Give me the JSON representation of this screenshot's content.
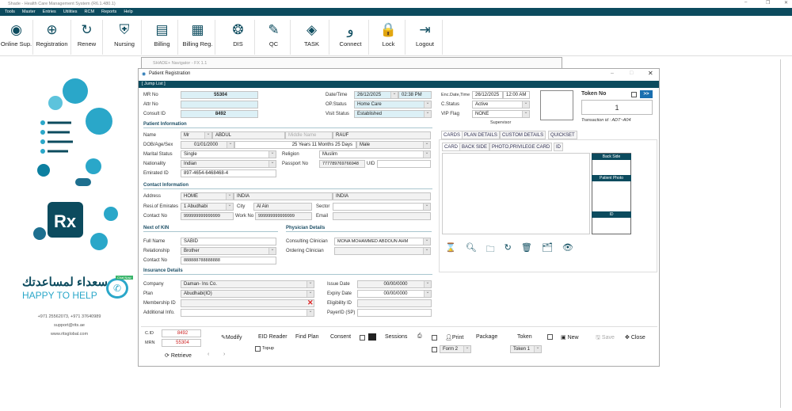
{
  "app": {
    "title": "Shade - Health Care Management System (R6.1.480.1)"
  },
  "menu": [
    "Tools",
    "Master",
    "Entries",
    "Utilities",
    "RCM",
    "Reports",
    "Help"
  ],
  "toolbar": [
    {
      "label": "Online Sup.",
      "icon": "online-support-icon",
      "glyph": "◉"
    },
    {
      "label": "Registration",
      "icon": "registration-icon",
      "glyph": "⊕"
    },
    {
      "label": "Renew",
      "icon": "renew-icon",
      "glyph": "↻"
    },
    {
      "label": "Nursing",
      "icon": "nursing-icon",
      "glyph": "⛨"
    },
    {
      "label": "Billing",
      "icon": "billing-icon",
      "glyph": "▤"
    },
    {
      "label": "Billing Reg.",
      "icon": "billing-register-icon",
      "glyph": "▦"
    },
    {
      "label": "DIS",
      "icon": "dis-icon",
      "glyph": "❂"
    },
    {
      "label": "QC",
      "icon": "qc-icon",
      "glyph": "✎"
    },
    {
      "label": "TASK",
      "icon": "task-icon",
      "glyph": "◈"
    },
    {
      "label": "Connect",
      "icon": "connect-icon",
      "glyph": "ﻭ"
    },
    {
      "label": "Lock",
      "icon": "lock-icon",
      "glyph": "🔒"
    },
    {
      "label": "Logout",
      "icon": "logout-icon",
      "glyph": "⇥"
    }
  ],
  "sidebar": {
    "arabic": "سعداء لمساعدتك",
    "slogan": "HAPPY TO HELP",
    "badge": "Chat Now",
    "phone": "+971 25562073, +971 37640989",
    "email": "support@rits.ae",
    "web": "www.ritsglobal.com"
  },
  "navigator": {
    "title": "SHADE+ Navigator - FX 1.1"
  },
  "form": {
    "title": "Patient Registration",
    "jump": "[ Jump List ]",
    "mr_label": "MR No",
    "mr": "55304",
    "attr_label": "Attr No",
    "consult_label": "Consult ID",
    "consult": "8492",
    "dt_label": "Date/Time",
    "date": "26/12/2025",
    "time": "02:38 PM",
    "op_label": "OP.Status",
    "op": "Home Care",
    "visit_label": "Visit Status",
    "visit": "Established",
    "enc_label": "Enc.Date,Time",
    "enc_date": "26/12/2025",
    "enc_time": "12:00 AM",
    "cstatus_label": "C.Status",
    "cstatus": "Active",
    "vip_label": "VIP Flag",
    "vip": "NONE",
    "supervisor": "Supervisor",
    "token_label": "Token No",
    "token_btn": ">>",
    "token": "1",
    "txn": "Transaction id :  ADT~A04",
    "pi": {
      "header": "Patient Information",
      "name_label": "Name",
      "title": "Mr",
      "first": "ABDUL",
      "middle_ph": "Middle Name",
      "last": "RAUF",
      "dob_label": "DOB/Age/Sex",
      "dob": "01/01/2000",
      "age": "25 Years 11 Months 25 Days",
      "sex": "Male",
      "marital_label": "Marital Status",
      "marital": "Single",
      "religion_label": "Religion",
      "religion": "Muslim",
      "nat_label": "Nationality",
      "nat": "Indian",
      "passport_label": "Passport  No",
      "passport": "777789769766948",
      "uid_label": "UID",
      "eid_label": "Emirated ID",
      "eid": "897-4654-6468468-4"
    },
    "ci": {
      "header": "Contact Information",
      "addr_label": "Address",
      "addr1": "HOME",
      "addr2": "INDIA",
      "addr3": "INDIA",
      "res_label": "Resi.of Emirates",
      "res": "1 Abudhabi",
      "city_label": "City",
      "city": "Al Ain",
      "sector_label": "Sector",
      "contact_label": "Contact No",
      "contact": "999999999999999",
      "work_label": "Work No",
      "work": "999999999999999",
      "email_label": "Email"
    },
    "kin": {
      "header": "Next of KIN",
      "name_label": "Full Name",
      "name": "SABID",
      "rel_label": "Relationship",
      "rel": "Brother",
      "contact_label": "Contact No",
      "contact": "888888788888888"
    },
    "phys": {
      "header": "Physician Details",
      "cons_label": "Consulting Clinician",
      "cons": "MONA MOHAMMED ABDOUN AHM",
      "ord_label": "Ordering Clinician"
    },
    "ins": {
      "header": "Insurance Details",
      "company_label": "Company",
      "company": "Daman- Ins Co.",
      "plan_label": "Plan",
      "plan": "Abudhabi(IO)",
      "member_label": "Membership ID",
      "add_label": "Additional Info.",
      "issue_label": "Issue Date",
      "issue": "00/00/0000",
      "expiry_label": "Expiry Date",
      "expiry": "00/00/0000",
      "elig_label": "Eligibility ID",
      "payer_label": "PayerID (SP)"
    },
    "cards": {
      "tabs": [
        "CARDS",
        "PLAN DETAILS",
        "CUSTOM DETAILS",
        "QUICKSET"
      ],
      "subtabs": [
        "CARD",
        "BACK SIDE",
        "PHOTO,PRIVILEGE CARD",
        "ID"
      ],
      "slots": [
        "Back Side",
        "Patient Photo",
        "ID"
      ]
    },
    "bottom": {
      "cid_label": "C.ID",
      "cid": "8492",
      "mrn_label": "MRN",
      "mrn": "55304",
      "retrieve": "Retrieve",
      "modify": "Modify",
      "eid": "EID Reader",
      "findplan": "Find Plan",
      "consent": "Consent",
      "sessions": "Sessions",
      "print": "Print",
      "package": "Package",
      "token": "Token",
      "new": "New",
      "save": "Save",
      "close": "Close",
      "topup": "Topup",
      "form": "Form 2",
      "token_sel": "Token 1"
    }
  },
  "colors": {
    "brand": "#0c4b5e",
    "field_blue": "#dcf0f6",
    "accent": "#1a6fb0"
  }
}
